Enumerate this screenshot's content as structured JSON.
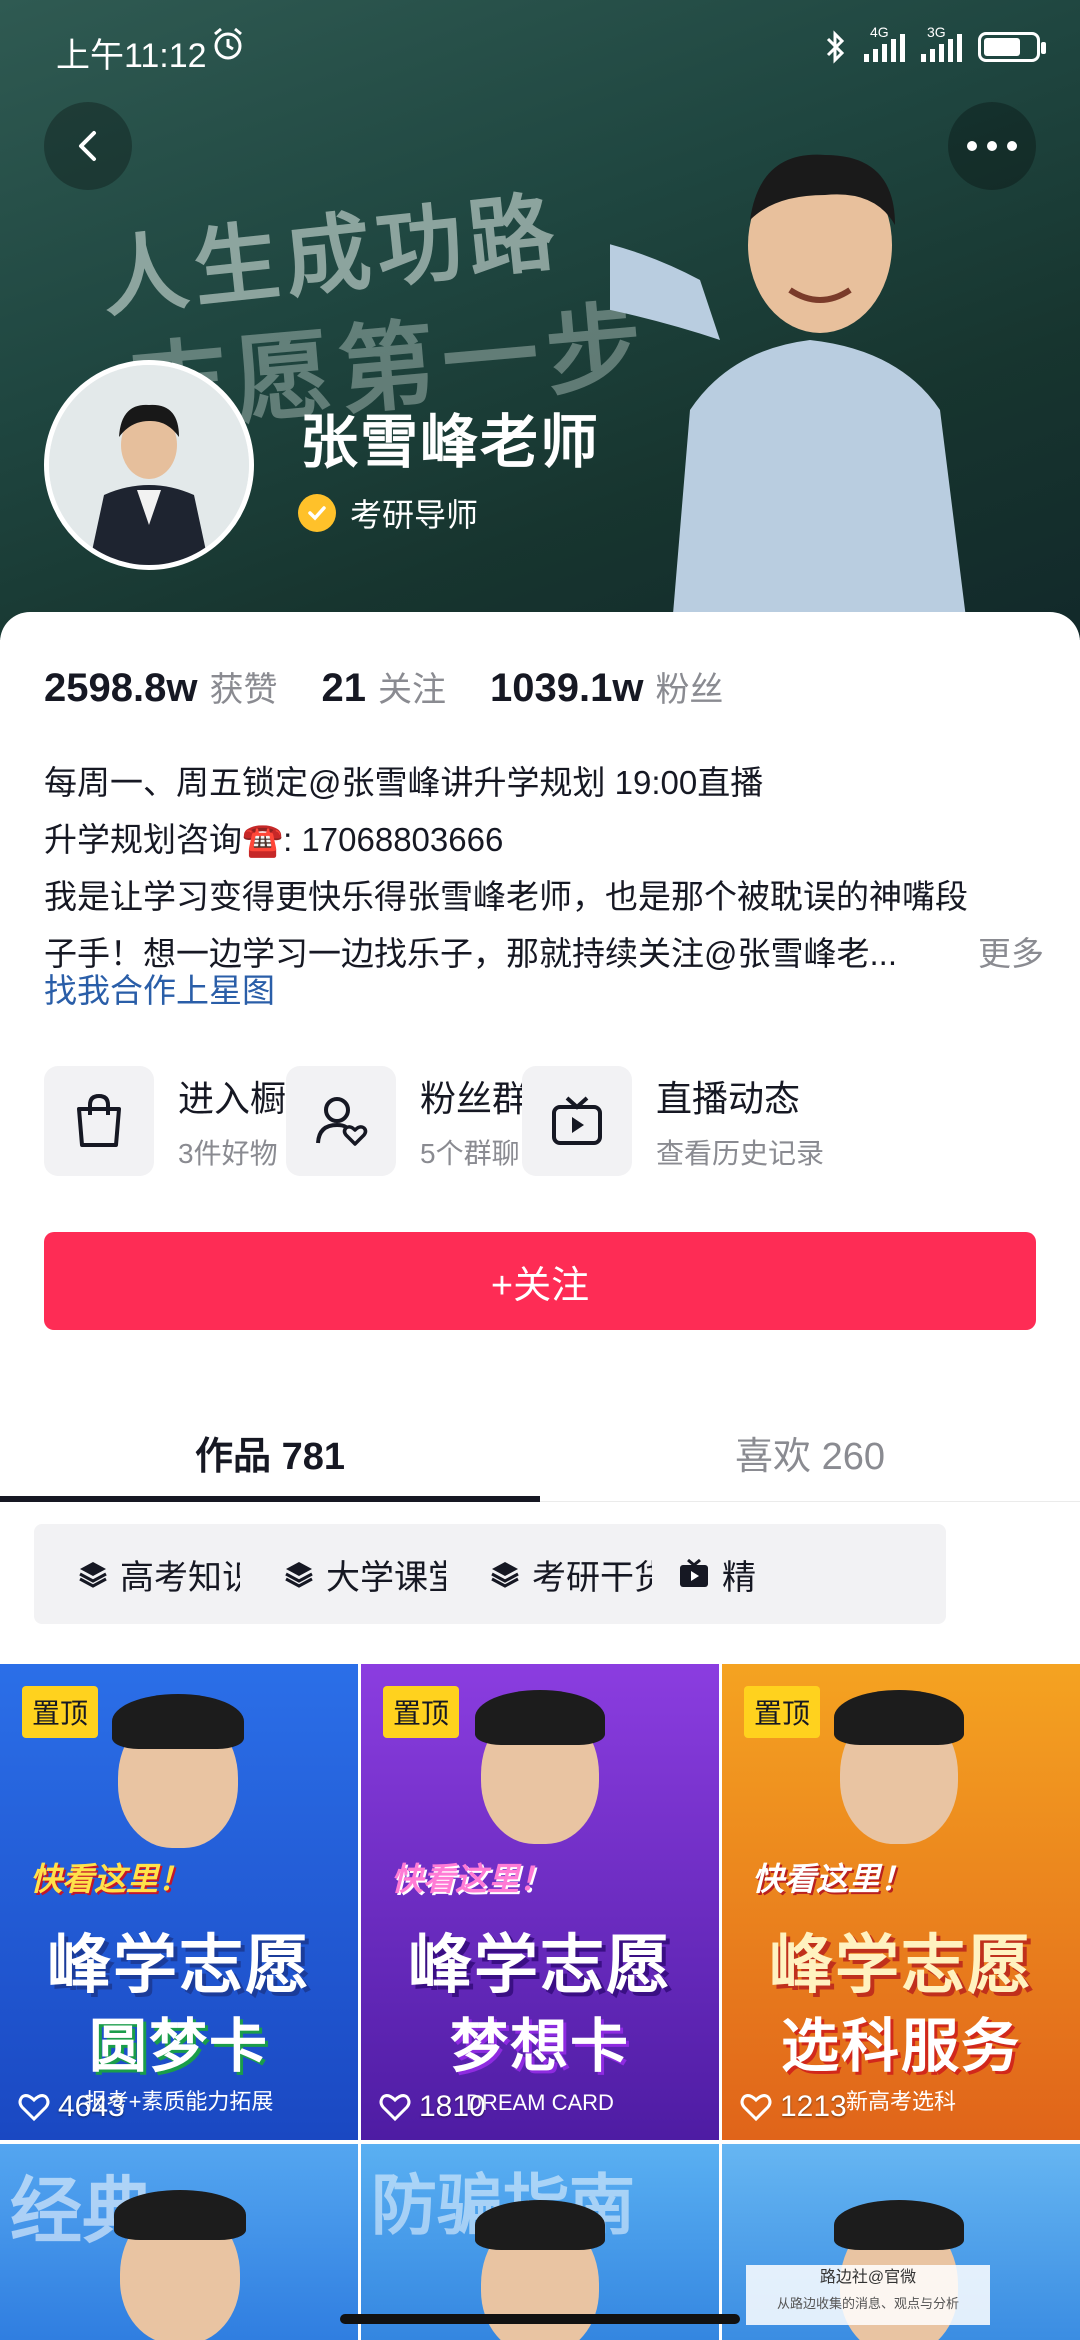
{
  "status_bar": {
    "time": "上午11:12",
    "net1": "4G",
    "net2": "3G"
  },
  "header": {
    "cover_text_1": "人生成功路",
    "cover_text_2": "志愿第一步",
    "nickname": "张雪峰老师",
    "verify_label": "考研导师"
  },
  "stats": [
    {
      "value": "2598.8w",
      "label": "获赞"
    },
    {
      "value": "21",
      "label": "关注"
    },
    {
      "value": "1039.1w",
      "label": "粉丝"
    }
  ],
  "bio": {
    "lines": [
      "每周一、周五锁定@张雪峰讲升学规划  19:00直播",
      "升学规划咨询☎️: 17068803666",
      "我是让学习变得更快乐得张雪峰老师，也是那个被耽误的神嘴段",
      "子手！想一边学习一边找乐子，那就持续关注@张雪峰老..."
    ],
    "more": "更多",
    "starmap_link": "找我合作上星图"
  },
  "entries": [
    {
      "title": "进入橱窗",
      "subtitle": "3件好物",
      "icon": "shopping-bag-icon"
    },
    {
      "title": "粉丝群",
      "subtitle": "5个群聊",
      "icon": "fan-group-icon"
    },
    {
      "title": "直播动态",
      "subtitle": "查看历史记录",
      "icon": "tv-icon"
    }
  ],
  "follow_button": "+关注",
  "tabs": [
    {
      "label": "作品 781",
      "active": true
    },
    {
      "label": "喜欢 260",
      "active": false
    }
  ],
  "collections": [
    {
      "label": "高考知识"
    },
    {
      "label": "大学课堂"
    },
    {
      "label": "考研干货"
    },
    {
      "label": "精"
    }
  ],
  "videos": [
    {
      "pinned": "置顶",
      "likes": "4643",
      "hook": "快看这里！",
      "title1": "峰学志愿",
      "title2": "圆梦卡",
      "footer": "报考+素质能力拓展",
      "bg": "#1f5bd6"
    },
    {
      "pinned": "置顶",
      "likes": "1810",
      "hook": "快看这里！",
      "title1": "峰学志愿",
      "title2": "梦想卡",
      "footer": "DREAM CARD",
      "bg": "#6a2bc4"
    },
    {
      "pinned": "置顶",
      "likes": "1213",
      "hook": "快看这里！",
      "title1": "峰学志愿",
      "title2": "选科服务",
      "footer": "新高考选科",
      "bg": "#f08a12"
    }
  ],
  "row2_texts": [
    "经典",
    "防骗指南",
    ""
  ],
  "watermark": {
    "line1": "路边社@官微",
    "line2": "从路边收集的消息、观点与分析"
  },
  "colors": {
    "accent": "#fe2c55",
    "link": "#2a5ea8",
    "pin": "#ffd21e",
    "verify": "#ffc12a"
  }
}
